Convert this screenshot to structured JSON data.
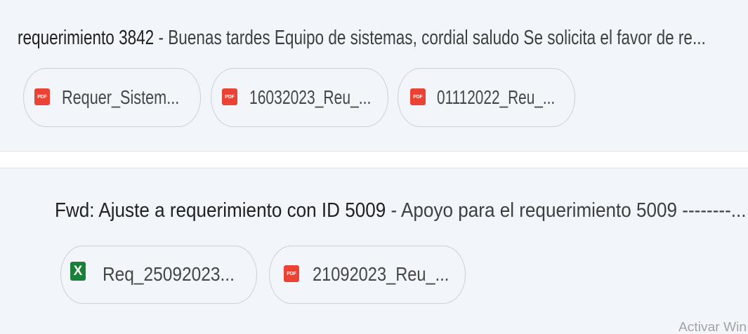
{
  "emails": [
    {
      "subject": "requerimiento 3842",
      "separator": "-",
      "snippet": "Buenas tardes Equipo de sistemas, cordial saludo Se solicita el favor de re...",
      "attachments": [
        {
          "name": "Requer_Sistem...",
          "icon": "pdf-icon"
        },
        {
          "name": "16032023_Reu_...",
          "icon": "pdf-icon"
        },
        {
          "name": "01112022_Reu_...",
          "icon": "pdf-icon"
        }
      ]
    },
    {
      "subject": "Fwd: Ajuste a requerimiento con ID 5009",
      "separator": "-",
      "snippet": "Apoyo para el requerimiento 5009 --------...",
      "attachments": [
        {
          "name": "Req_25092023...",
          "icon": "excel-icon"
        },
        {
          "name": "21092023_Reu_...",
          "icon": "pdf-icon"
        }
      ]
    }
  ],
  "icons": {
    "pdf": {
      "name": "pdf-icon",
      "text": "PDF"
    },
    "excel": {
      "name": "excel-icon",
      "text": "X"
    }
  },
  "watermark": "Activar Win",
  "colors": {
    "page_bg": "#ffffff",
    "row_bg": "#f2f5fa",
    "divider": "#dfe3e8",
    "subject_text": "#202124",
    "snippet_text": "#3c4043",
    "chip_border": "#cdd1d6",
    "chip_text": "#444746",
    "pdf_icon": "#ea4335",
    "excel_icon": "#188038",
    "watermark_text": "#a3a3a3"
  }
}
